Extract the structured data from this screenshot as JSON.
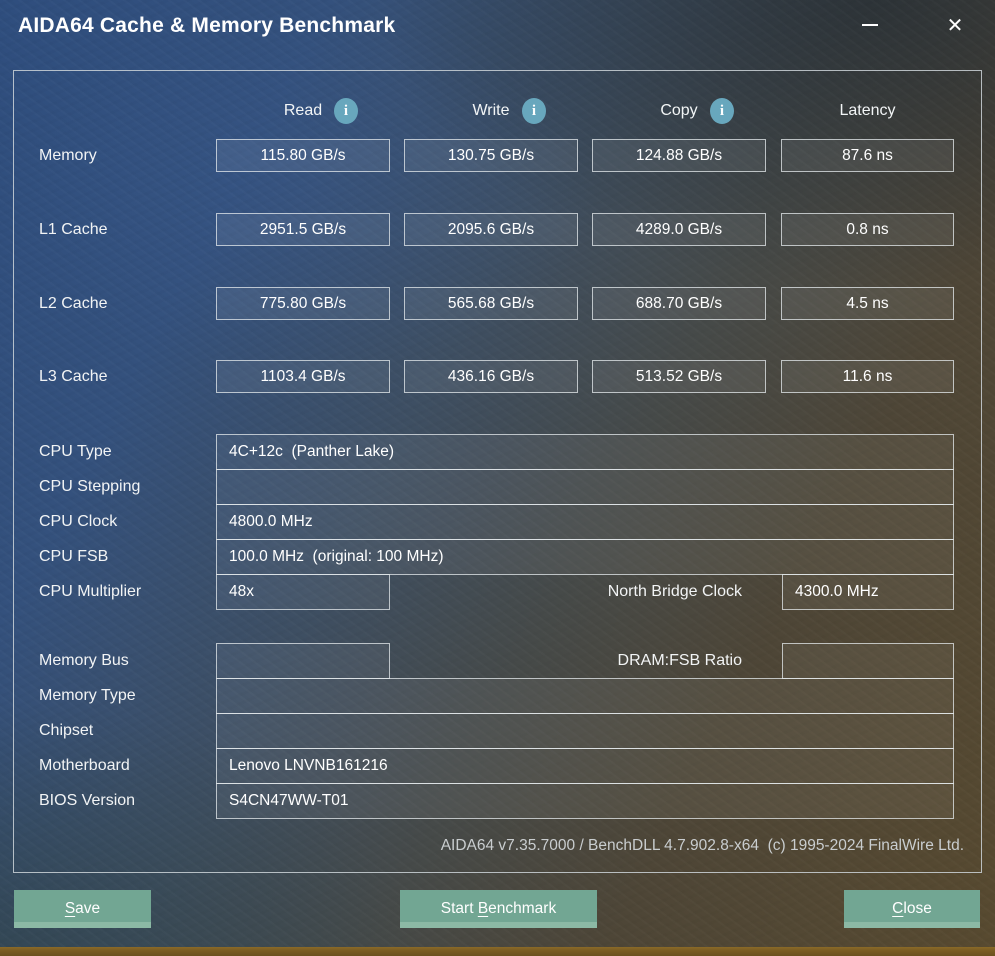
{
  "window": {
    "title": "AIDA64 Cache & Memory Benchmark",
    "close_glyph": "✕"
  },
  "benchmark": {
    "columns": [
      {
        "label": "Read"
      },
      {
        "label": "Write"
      },
      {
        "label": "Copy"
      },
      {
        "label": "Latency"
      }
    ],
    "info_glyph": "i",
    "rows": [
      {
        "label": "Memory",
        "read": "115.80 GB/s",
        "write": "130.75 GB/s",
        "copy": "124.88 GB/s",
        "latency": "87.6 ns"
      },
      {
        "label": "L1 Cache",
        "read": "2951.5 GB/s",
        "write": "2095.6 GB/s",
        "copy": "4289.0 GB/s",
        "latency": "0.8 ns"
      },
      {
        "label": "L2 Cache",
        "read": "775.80 GB/s",
        "write": "565.68 GB/s",
        "copy": "688.70 GB/s",
        "latency": "4.5 ns"
      },
      {
        "label": "L3 Cache",
        "read": "1103.4 GB/s",
        "write": "436.16 GB/s",
        "copy": "513.52 GB/s",
        "latency": "11.6 ns"
      }
    ]
  },
  "cpu": {
    "type_label": "CPU Type",
    "type_value": "4C+12c  (Panther Lake)",
    "stepping_label": "CPU Stepping",
    "stepping_value": "",
    "clock_label": "CPU Clock",
    "clock_value": "4800.0 MHz",
    "fsb_label": "CPU FSB",
    "fsb_value": "100.0 MHz  (original: 100 MHz)",
    "multiplier_label": "CPU Multiplier",
    "multiplier_value": "48x",
    "north_bridge_label": "North Bridge Clock",
    "north_bridge_value": "4300.0 MHz"
  },
  "memory": {
    "bus_label": "Memory Bus",
    "bus_value": "",
    "dram_fsb_label": "DRAM:FSB Ratio",
    "dram_fsb_value": "",
    "type_label": "Memory Type",
    "type_value": "",
    "chipset_label": "Chipset",
    "chipset_value": "",
    "motherboard_label": "Motherboard",
    "motherboard_value": "Lenovo LNVNB161216",
    "bios_label": "BIOS Version",
    "bios_value": "S4CN47WW-T01"
  },
  "footer": {
    "credits": "AIDA64 v7.35.7000 / BenchDLL 4.7.902.8-x64  (c) 1995-2024 FinalWire Ltd."
  },
  "buttons": {
    "save": {
      "pre": "",
      "accel": "S",
      "post": "ave"
    },
    "start": {
      "pre": "Start ",
      "accel": "B",
      "post": "enchmark"
    },
    "close": {
      "pre": "",
      "accel": "C",
      "post": "lose"
    }
  },
  "colors": {
    "button_green": "#72a693",
    "info_icon_teal": "#68a7bd",
    "background_blue": "#2f4e7e",
    "background_brown": "#584a30"
  }
}
